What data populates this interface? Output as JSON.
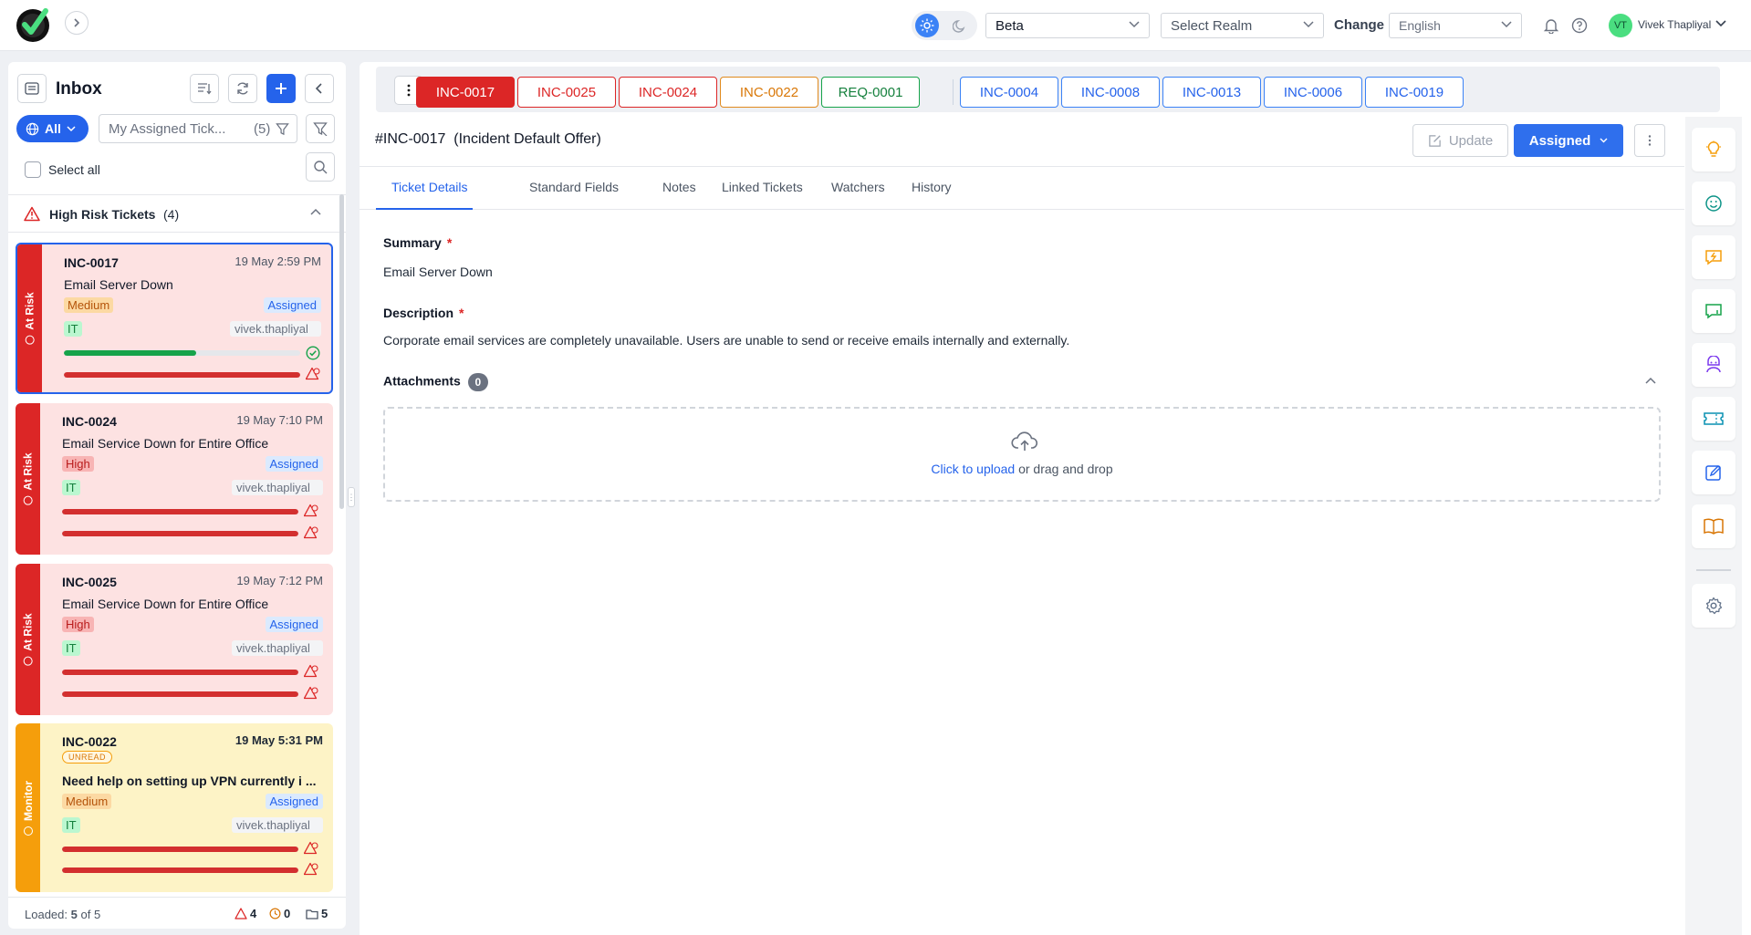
{
  "topbar": {
    "env_value": "Beta",
    "realm_placeholder": "Select Realm",
    "change_label": "Change",
    "language_value": "English",
    "user_initials": "VT",
    "user_name": "Vivek Thapliyal"
  },
  "inbox": {
    "title": "Inbox",
    "all_label": "All",
    "filter_label": "My Assigned Tick...",
    "filter_count": "(5)",
    "select_all": "Select all",
    "section_title": "High Risk Tickets",
    "section_count": "(4)",
    "tickets": [
      {
        "id": "INC-0017",
        "date": "19 May 2:59 PM",
        "summary": "Email Server Down",
        "priority": "Medium",
        "status": "Assigned",
        "group": "IT",
        "assignee": "vivek.thapliyal",
        "flag": "At Risk",
        "unread": "",
        "bar1_progress": 0.56,
        "bar2_progress": 1.0
      },
      {
        "id": "INC-0024",
        "date": "19 May 7:10 PM",
        "summary": "Email Service Down for Entire Office",
        "priority": "High",
        "status": "Assigned",
        "group": "IT",
        "assignee": "vivek.thapliyal",
        "flag": "At Risk",
        "unread": "",
        "bar1_progress": 1.0,
        "bar2_progress": 1.0
      },
      {
        "id": "INC-0025",
        "date": "19 May 7:12 PM",
        "summary": "Email Service Down for Entire Office",
        "priority": "High",
        "status": "Assigned",
        "group": "IT",
        "assignee": "vivek.thapliyal",
        "flag": "At Risk",
        "unread": "",
        "bar1_progress": 1.0,
        "bar2_progress": 1.0
      },
      {
        "id": "INC-0022",
        "date": "19 May 5:31 PM",
        "summary": "Need help on setting up VPN currently i ...",
        "priority": "Medium",
        "status": "Assigned",
        "group": "IT",
        "assignee": "vivek.thapliyal",
        "flag": "Monitor",
        "unread": "UNREAD",
        "bar1_progress": 1.0,
        "bar2_progress": 1.0
      }
    ],
    "footer": {
      "loaded_label": "Loaded:",
      "loaded_count": "5",
      "loaded_of": "of 5",
      "risk_count": "4",
      "pending_count": "0",
      "folder_count": "5"
    }
  },
  "tabs": [
    {
      "label": "INC-0017",
      "style": "active"
    },
    {
      "label": "INC-0025",
      "style": "red"
    },
    {
      "label": "INC-0024",
      "style": "red"
    },
    {
      "label": "INC-0022",
      "style": "orange"
    },
    {
      "label": "REQ-0001",
      "style": "green"
    },
    {
      "label": "INC-0004",
      "style": "blue"
    },
    {
      "label": "INC-0008",
      "style": "blue"
    },
    {
      "label": "INC-0013",
      "style": "blue"
    },
    {
      "label": "INC-0006",
      "style": "blue"
    },
    {
      "label": "INC-0019",
      "style": "blue"
    }
  ],
  "ticket": {
    "title": "#INC-0017  (Incident Default Offer)",
    "update_label": "Update",
    "status_label": "Assigned",
    "detail_tabs": [
      "Ticket Details",
      "Standard Fields",
      "Notes",
      "Linked Tickets",
      "Watchers",
      "History"
    ],
    "summary_label": "Summary",
    "summary_value": "Email Server Down",
    "description_label": "Description",
    "description_value": "Corporate email services are completely unavailable. Users are unable to send or receive emails internally and externally.",
    "attachments_label": "Attachments",
    "attachments_count": "0",
    "upload_link": "Click to upload",
    "upload_rest": " or drag and drop",
    "required_mark": "*"
  },
  "colors": {
    "primary": "#2563eb",
    "risk": "#dc2626",
    "monitor": "#f59e0b",
    "success": "#16a34a"
  },
  "rail_icons": [
    "lightbulb-icon",
    "smiley-icon",
    "chat-alert-icon",
    "chat-flag-icon",
    "robot-icon",
    "ticket-icon",
    "edit-box-icon",
    "book-icon",
    "gear-icon"
  ]
}
